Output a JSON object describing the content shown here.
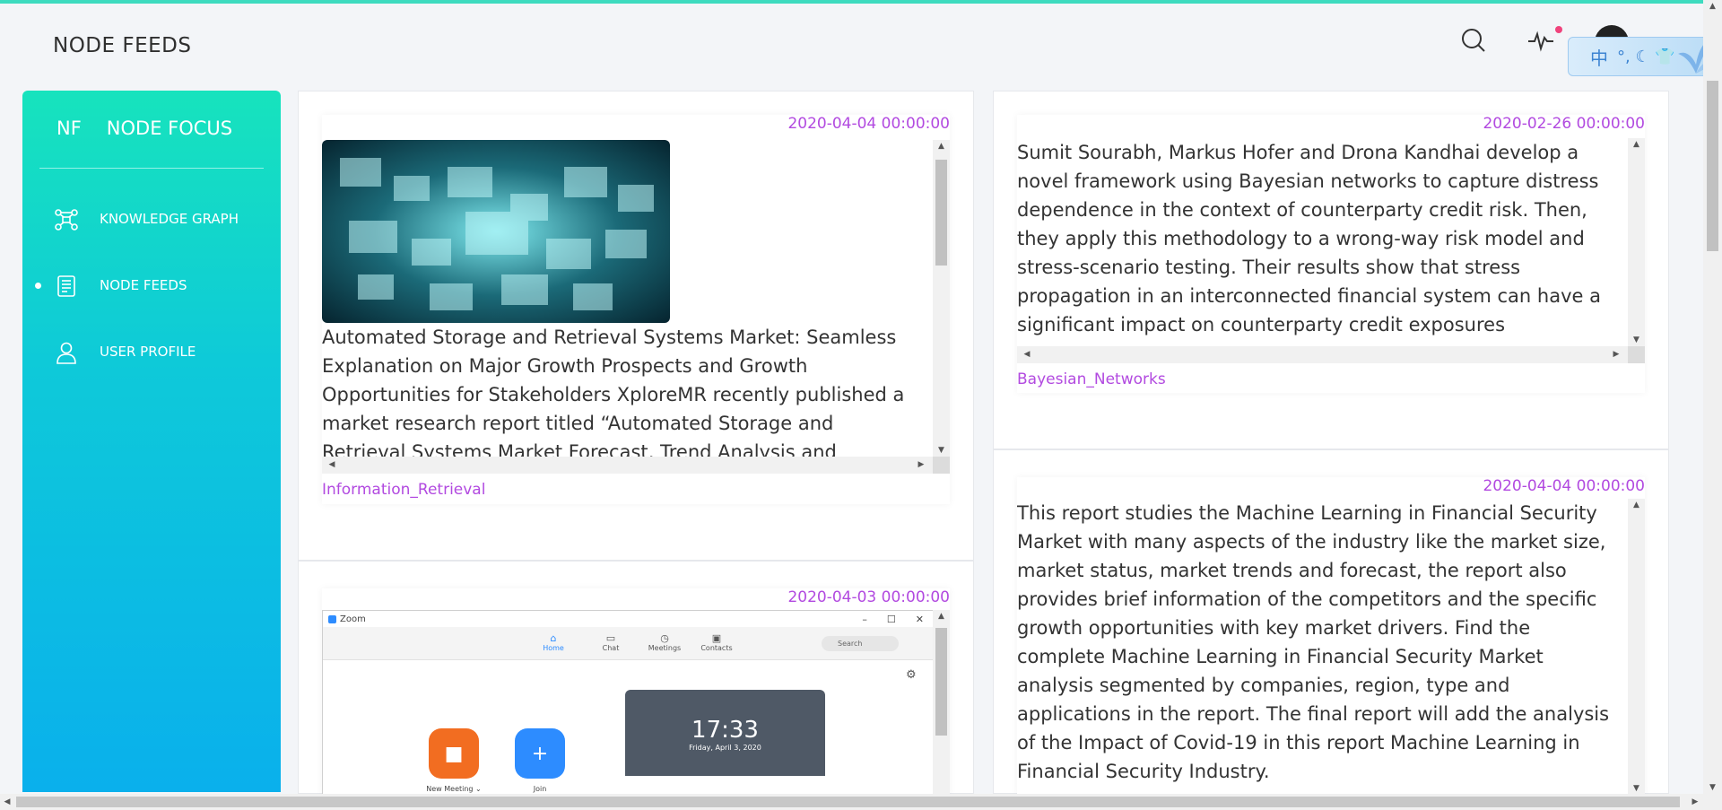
{
  "header": {
    "page_title": "NODE FEEDS",
    "ime_char": "中",
    "ime_symbols": "°, ☾ 👕"
  },
  "sidebar": {
    "brand_abbr": "NF",
    "brand_name": "NODE FOCUS",
    "items": [
      {
        "label": "KNOWLEDGE GRAPH",
        "icon": "graph-icon",
        "active": false
      },
      {
        "label": "NODE FEEDS",
        "icon": "document-icon",
        "active": true
      },
      {
        "label": "USER PROFILE",
        "icon": "user-icon",
        "active": false
      }
    ]
  },
  "feeds": {
    "left": [
      {
        "date": "2020-04-04 00:00:00",
        "text": "Automated Storage and Retrieval Systems Market: Seamless Explanation on Major Growth Prospects and Growth Opportunities for Stakeholders XploreMR recently published a market research report titled “Automated Storage and Retrieval Systems Market Forecast, Trend Analysis and",
        "tag": "Information_Retrieval"
      },
      {
        "date": "2020-04-03 00:00:00",
        "zoom": {
          "app_title": "Zoom",
          "tabs": [
            "Home",
            "Chat",
            "Meetings",
            "Contacts"
          ],
          "search_placeholder": "Search",
          "time": "17:33",
          "date": "Friday, April 3, 2020",
          "buttons": [
            "New Meeting ⌄",
            "Join"
          ]
        }
      }
    ],
    "right": [
      {
        "date": "2020-02-26 00:00:00",
        "text": "Sumit Sourabh, Markus Hofer and Drona Kandhai develop a novel framework using Bayesian networks to capture distress dependence in the context of counterparty credit risk. Then, they apply this methodology to a wrong-way risk model and stress-scenario testing. Their results show that stress propagation in an interconnected financial system can have a significant impact on counterparty credit exposures",
        "tag": "Bayesian_Networks"
      },
      {
        "date": "2020-04-04 00:00:00",
        "text": "This report studies the Machine Learning in Financial Security Market with many aspects of the industry like the market size, market status, market trends and forecast, the report also provides brief information of the competitors and the specific growth opportunities with key market drivers. Find the complete Machine Learning in Financial Security Market analysis segmented by companies, region, type and applications in the report. The final report will add the analysis of the Impact of Covid-19 in this report Machine Learning in Financial Security Industry."
      }
    ]
  },
  "colors": {
    "accent": "#3ddbbf",
    "tag_purple": "#b24ae0",
    "sidebar_top": "#17e3bd",
    "sidebar_bottom": "#0ab0ec"
  }
}
